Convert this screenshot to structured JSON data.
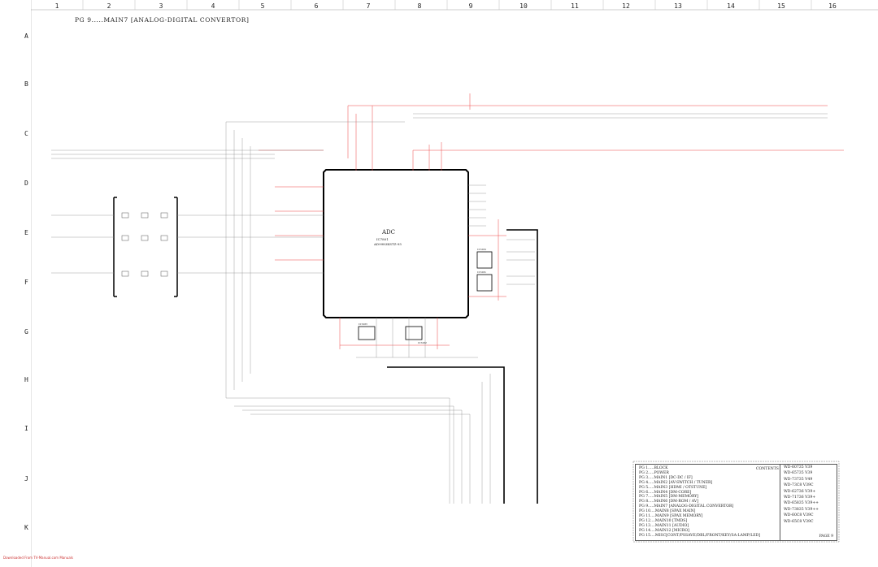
{
  "columns": [
    "1",
    "2",
    "3",
    "4",
    "5",
    "6",
    "7",
    "8",
    "9",
    "10",
    "11",
    "12",
    "13",
    "14",
    "15",
    "16"
  ],
  "rows": [
    "A",
    "B",
    "C",
    "D",
    "E",
    "F",
    "G",
    "H",
    "I",
    "J",
    "K"
  ],
  "page_title": "PG 9.....MAIN7 [ANALOG-DIGITAL CONVERTOR]",
  "chip": {
    "name": "ADC",
    "ref": "IC7801",
    "part": "AD9983KSTZ-95"
  },
  "ic_labels": {
    "ic1": "IC7A04",
    "ic2": "IC7A01",
    "ic3": "IC7A03",
    "ic4": "IC7A02"
  },
  "contents": {
    "title": "CONTENTS",
    "items": [
      "PG 1.....BLOCK",
      "PG 2.....POWER",
      "PG 3.....MAIN1 [DC-DC / IF]",
      "PG 4.....MAIN2 [AV-SWITCH / TUNER]",
      "PG 5.....MAIN3 [HDMI / OTSTUNE]",
      "PG 6.....MAIN4 [DM-CORE]",
      "PG 7.....MAIN5 [DM-MEMORY]",
      "PG 8.....MAIN6 [DM-ROM / AV]",
      "PG 9.....MAIN7 [ANALOG-DIGITAL CONVERTOR]",
      "PG 10....MAIN8 [SPAX MAIN]",
      "PG 11....MAIN9 [SPAX MEMORY]",
      "PG 12....MAIN10 [TMDS]",
      "PG 13....MAIN11 [AUDIO]",
      "PG 14....MAIN12 [MICRO]",
      "PG 15....MISC[CONT/PSSAVE/DBL/FRONT/KEY/SA-LAMP/LED]"
    ],
    "models": [
      "WD-60735 V39",
      "WD-65735 V39",
      "WD-73735 V49",
      "WD-73C8  V39C",
      "WD-62736 V39+",
      "WD-71736 V39+",
      "WD-65835 V39++",
      "WD-73835 V39++",
      "WD-60C8  V39C",
      "WD-65C8  V39C"
    ],
    "page": "PAGE 9"
  },
  "footer": "Downloaded From TV-Manual.com Manuals"
}
